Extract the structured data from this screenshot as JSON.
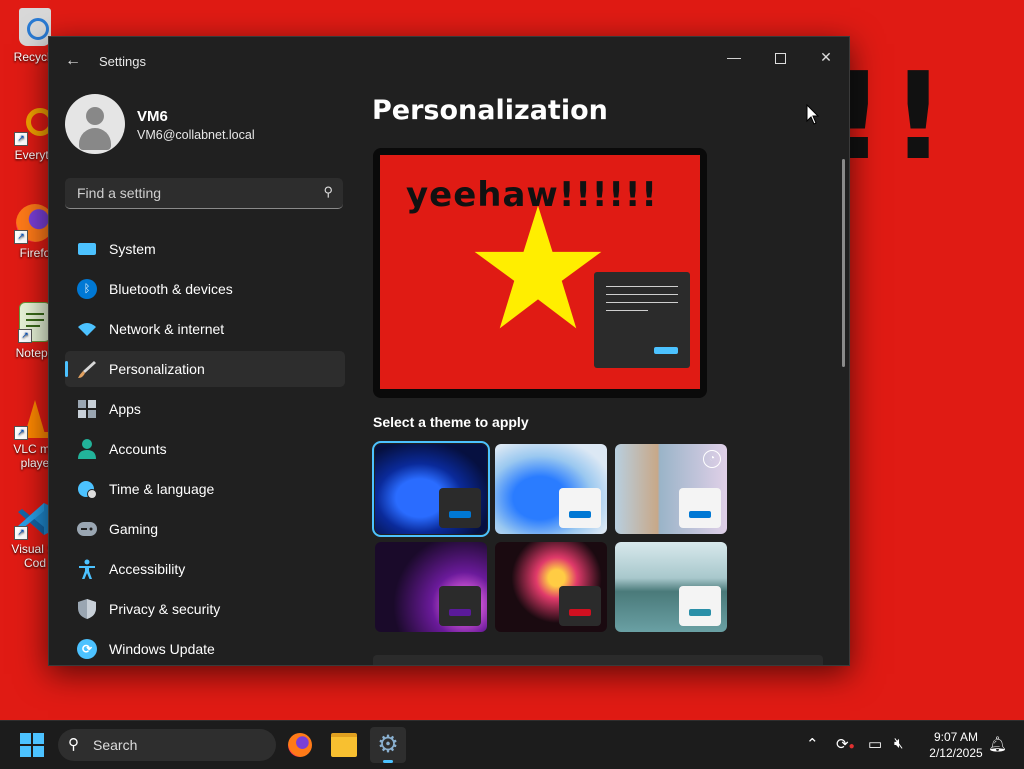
{
  "desktop": {
    "icons": [
      {
        "label": "Recycle"
      },
      {
        "label": "Everyth"
      },
      {
        "label": "Firefo"
      },
      {
        "label": "Notepa"
      },
      {
        "label": "VLC me playe"
      },
      {
        "label": "Visual St Cod"
      }
    ],
    "wallpaper_text": "!!"
  },
  "window": {
    "title": "Settings",
    "profile": {
      "name": "VM6",
      "email": "VM6@collabnet.local"
    },
    "search": {
      "placeholder": "Find a setting"
    },
    "nav": [
      {
        "label": "System",
        "icon": "monitor-icon",
        "color": "#4cc2ff"
      },
      {
        "label": "Bluetooth & devices",
        "icon": "bluetooth-icon",
        "color": "#0078d4"
      },
      {
        "label": "Network & internet",
        "icon": "wifi-icon",
        "color": "#4cc2ff"
      },
      {
        "label": "Personalization",
        "icon": "brush-icon",
        "color": "#e0a060",
        "selected": true
      },
      {
        "label": "Apps",
        "icon": "apps-icon",
        "color": "#9aa6b2"
      },
      {
        "label": "Accounts",
        "icon": "person-icon",
        "color": "#22b39a"
      },
      {
        "label": "Time & language",
        "icon": "globe-clock-icon",
        "color": "#4cc2ff"
      },
      {
        "label": "Gaming",
        "icon": "controller-icon",
        "color": "#9aa6b2"
      },
      {
        "label": "Accessibility",
        "icon": "accessibility-icon",
        "color": "#4cc2ff"
      },
      {
        "label": "Privacy & security",
        "icon": "shield-icon",
        "color": "#9aa6b2"
      },
      {
        "label": "Windows Update",
        "icon": "sync-icon",
        "color": "#4cc2ff"
      }
    ],
    "content": {
      "page_title": "Personalization",
      "preview_text": "yeehaw!!!!!!",
      "section_label": "Select a theme to apply",
      "themes": [
        {
          "name": "windows-dark",
          "accent": "#0078d4",
          "selected": true
        },
        {
          "name": "windows-light",
          "accent": "#0078d4"
        },
        {
          "name": "windows-spotlight",
          "accent": "#0078d4"
        },
        {
          "name": "glow",
          "accent": "#5a1a9a"
        },
        {
          "name": "captured-motion",
          "accent": "#d01020"
        },
        {
          "name": "flow",
          "accent": "#2a8fa8"
        }
      ]
    }
  },
  "taskbar": {
    "search_label": "Search",
    "clock": {
      "time": "9:07 AM",
      "date": "2/12/2025"
    }
  }
}
